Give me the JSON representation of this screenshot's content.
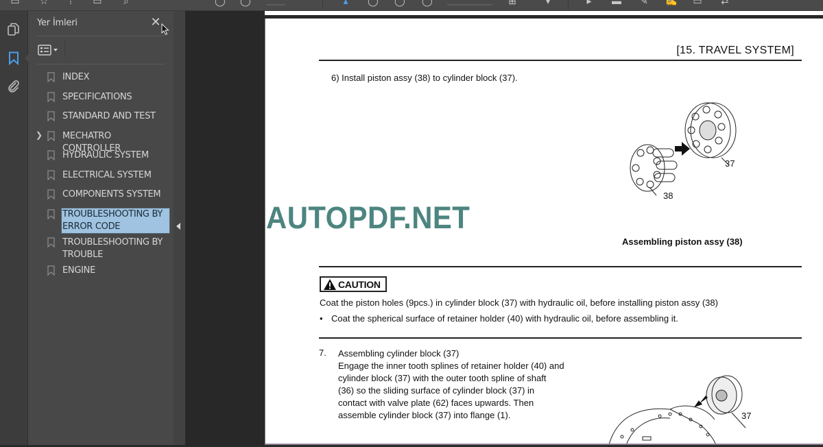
{
  "window": {
    "colors": {
      "accent": "#4a9fea",
      "selection": "#9fc3e0",
      "watermark": "#4d8580"
    }
  },
  "toolbar": {
    "icons": [
      "toolbar-icon",
      "star-icon",
      "upload-icon",
      "print-icon",
      "search-icon",
      "zoom-out-icon",
      "zoom-in-icon",
      "cursor-icon",
      "select-icon",
      "hand-icon",
      "fit-icon",
      "fit-width-icon",
      "dropdown-icon",
      "comment-icon",
      "highlight-icon",
      "draw-icon",
      "sign-icon",
      "stamp-icon",
      "share-icon"
    ]
  },
  "rail": {
    "items": [
      {
        "name": "pages-icon"
      },
      {
        "name": "bookmark-icon",
        "active": true
      },
      {
        "name": "attachment-icon"
      }
    ]
  },
  "panel": {
    "title": "Yer İmleri",
    "close_label": "✕",
    "options_icon": "list-options-icon",
    "bookmarks": [
      {
        "label": "INDEX"
      },
      {
        "label": "SPECIFICATIONS"
      },
      {
        "label": "STANDARD AND TEST"
      },
      {
        "label": "MECHATRO CONTROLLER",
        "expandable": true
      },
      {
        "label": "HYDRAULIC SYSTEM"
      },
      {
        "label": "ELECTRICAL SYSTEM"
      },
      {
        "label": "COMPONENTS SYSTEM"
      },
      {
        "label": "TROUBLESHOOTING BY ERROR CODE",
        "selected": true
      },
      {
        "label": "TROUBLESHOOTING BY TROUBLE"
      },
      {
        "label": "ENGINE"
      }
    ]
  },
  "document": {
    "section_header": "[15.   TRAVEL SYSTEM]",
    "step6": "6)    Install piston assy (38) to cylinder block (37).",
    "figure1": {
      "label_37": "37",
      "label_38": "38",
      "caption": "Assembling piston assy (38)"
    },
    "watermark": "AUTOPDF.NET",
    "caution": {
      "label": "CAUTION",
      "line1": "Coat the piston holes (9pcs.) in cylinder block (37) with hydraulic oil, before installing piston assy (38)",
      "bullet": "•",
      "line2": "Coat the spherical surface of retainer holder (40) with hydraulic oil, before assembling it."
    },
    "step7": {
      "number": "7.",
      "title": "Assembling cylinder block (37)",
      "body": "Engage the inner tooth splines of retainer holder (40) and cylinder block (37) with the outer tooth spline of shaft (36) so the sliding surface of cylinder block (37) in contact with valve plate (62) faces upwards. Then assemble cylinder block (37) into flange (1)."
    },
    "figure2": {
      "label_37": "37"
    }
  }
}
